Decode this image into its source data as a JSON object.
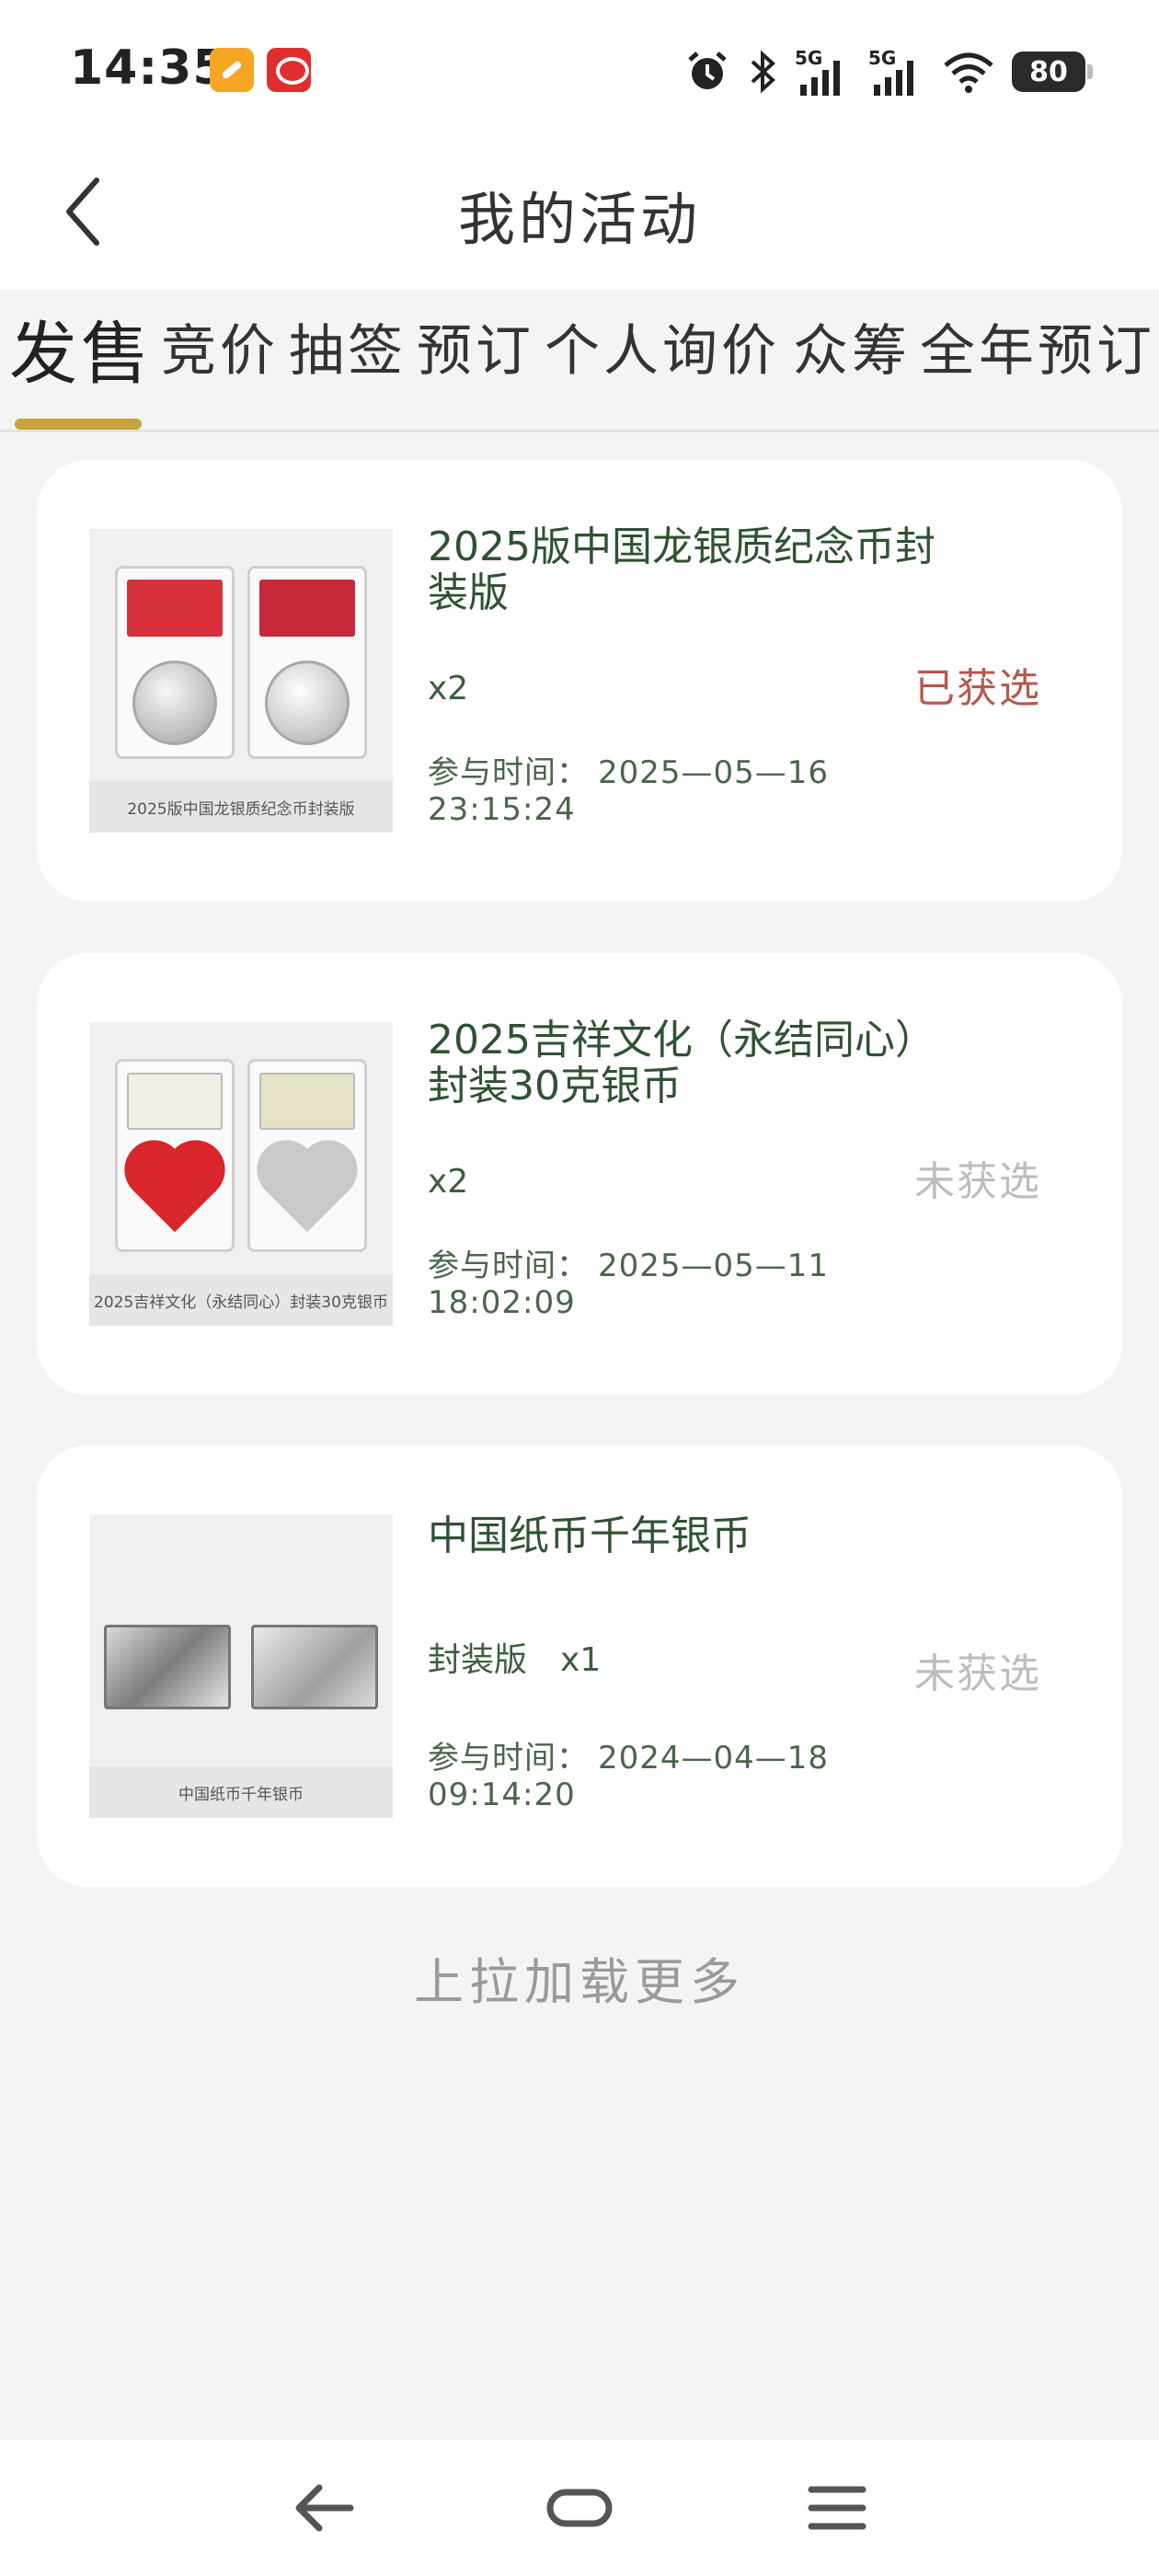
{
  "status_bar": {
    "time": "14:35",
    "battery": "80"
  },
  "header": {
    "title": "我的活动"
  },
  "tabs": [
    {
      "label": "发售",
      "active": true
    },
    {
      "label": "竞价",
      "active": false
    },
    {
      "label": "抽签",
      "active": false
    },
    {
      "label": "预订",
      "active": false
    },
    {
      "label": "个人询价",
      "active": false
    },
    {
      "label": "众筹",
      "active": false
    },
    {
      "label": "全年预订",
      "active": false
    }
  ],
  "activities": [
    {
      "image_caption": "2025版中国龙银质纪念币封装版",
      "title": "2025版中国龙银质纪念币封装版",
      "variant": "",
      "quantity": "x2",
      "time_label": "参与时间：",
      "date": "2025—05—16",
      "time": "23:15:24",
      "status": "已获选"
    },
    {
      "image_caption": "2025吉祥文化（永结同心）封装30克银币",
      "title": "2025吉祥文化（永结同心）封装30克银币",
      "variant": "",
      "quantity": "x2",
      "time_label": "参与时间：",
      "date": "2025—05—11",
      "time": "18:02:09",
      "status": "未获选"
    },
    {
      "image_caption": "中国纸币千年银币",
      "title": "中国纸币千年银币",
      "variant": "封装版",
      "quantity": "x1",
      "time_label": "参与时间：",
      "date": "2024—04—18",
      "time": "09:14:20",
      "status": "未获选"
    }
  ],
  "load_more": "上拉加载更多",
  "colors": {
    "accent": "#c8a43c",
    "status_won": "#b5584e",
    "status_lost": "#bdbdbd",
    "title_green": "#2f5232"
  },
  "icons": {
    "back": "chevron-left-icon",
    "nav_back": "arrow-left-icon",
    "nav_home": "home-pill-icon",
    "nav_menu": "menu-icon"
  }
}
